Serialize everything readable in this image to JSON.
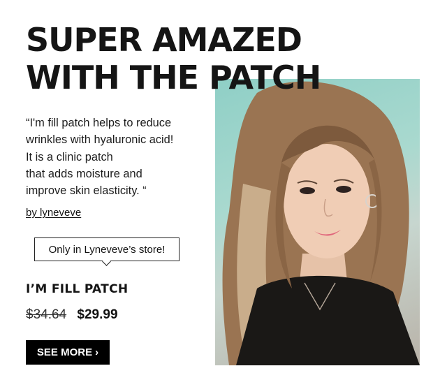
{
  "headline": {
    "line1": "SUPER AMAZED",
    "line2": "WITH THE PATCH"
  },
  "quote": {
    "lines": [
      "“I'm fill patch helps to reduce",
      "wrinkles with hyaluronic acid!",
      "It is a clinic patch",
      "that adds moisture and",
      "improve skin elasticity. “"
    ]
  },
  "byline": "by lyneveve",
  "store_callout": "Only in Lyneveve’s store!",
  "product": {
    "name": "I’M FILL PATCH",
    "old_price": "$34.64",
    "new_price": "$29.99"
  },
  "cta": {
    "label": "SEE MORE",
    "chevron": "›"
  },
  "icons": {
    "cta": "chevron-right-icon"
  },
  "colors": {
    "text": "#111111",
    "button_bg": "#000000",
    "button_text": "#ffffff",
    "photo_background": "#9fd5cb"
  }
}
